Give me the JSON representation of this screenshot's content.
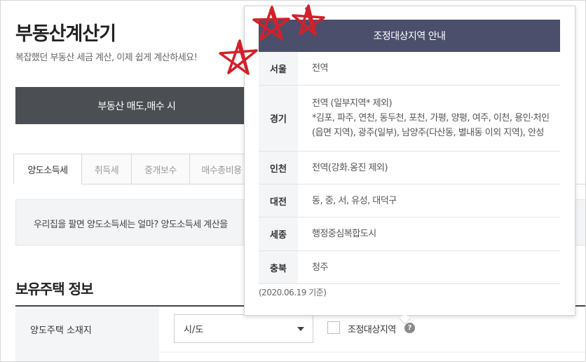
{
  "header": {
    "title": "부동산계산기",
    "subtitle": "복잡했던 부동산 세금 계산, 이제 쉽게 계산하세요!"
  },
  "main_tab": {
    "label": "부동산 매도,매수 시"
  },
  "sub_tabs": [
    {
      "label": "양도소득세",
      "active": true
    },
    {
      "label": "취득세",
      "active": false
    },
    {
      "label": "중개보수",
      "active": false
    },
    {
      "label": "매수총비용",
      "active": false
    }
  ],
  "info": {
    "text": "우리집을 팔면 양도소득세는 얼마? 양도소득세 계산을"
  },
  "section": {
    "title": "보유주택 정보"
  },
  "form": {
    "location_label": "양도주택 소재지",
    "select_value": "시/도",
    "checkbox_label": "조정대상지역",
    "help_icon": "?"
  },
  "popup": {
    "title": "조정대상지역 안내",
    "rows": [
      {
        "region": "서울",
        "area": "전역",
        "detail": ""
      },
      {
        "region": "경기",
        "area": "전역 (일부지역* 제외)",
        "detail": "*김포, 파주, 연천, 동두천, 포천, 가평, 양평, 여주, 이천, 용인·처인 (읍면 지역), 광주(일부), 남양주(다산동, 별내동 이외 지역), 안성"
      },
      {
        "region": "인천",
        "area": "전역(강화.옹진 제외)",
        "detail": ""
      },
      {
        "region": "대전",
        "area": "동, 중, 서, 유성, 대덕구",
        "detail": ""
      },
      {
        "region": "세종",
        "area": "행정중심복합도시",
        "detail": ""
      },
      {
        "region": "충북",
        "area": "청주",
        "detail": ""
      }
    ],
    "note": "(2020.06.19 기준)"
  },
  "colors": {
    "main_tab_bg": "#4b4e52",
    "popup_header_bg": "#4b4f6c",
    "star_annotation": "#d3202a"
  },
  "icons": {
    "help": "question-circle-icon",
    "select_arrow": "caret-down-icon",
    "annotation": "hand-drawn-star-icon"
  }
}
